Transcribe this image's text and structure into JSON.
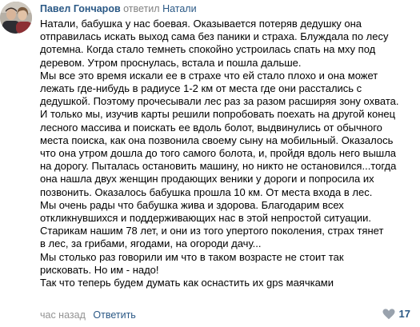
{
  "comment": {
    "author": "Павел Гончаров",
    "action": "ответил",
    "reply_to": "Натали",
    "lines": [
      "Натали, бабушка у нас боевая. Оказывается потеряв дедушку она",
      "отправилась искать выход сама без паники и страха. Блуждала по лесу",
      "дотемна. Когда стало темнеть спокойно устроилась спать на мху под",
      "деревом. Утром проснулась, встала и пошла дальше.",
      "Мы все это время искали ее в страхе что ей стало плохо и она может",
      "лежать где-нибудь в радиусе 1-2 км от места где они расстались с",
      "дедушкой. Поэтому прочесывали лес раз за разом расширяя зону охвата.",
      "И только мы, изучив карты решили попробовать поехать на другой конец",
      "лесного массива и поискать ее вдоль болот, выдвинулись от обычного",
      "места поиска, как она позвонила своему сыну на мобильный. Оказалось",
      "что она утром дошла до того самого болота, и, пройдя вдоль него вышла",
      "на дорогу. Пыталась остановить машину, но никто не остановился...тогда",
      "она нашла двух женщин продающих веники у дороги и попросила их",
      "позвонить. Оказалось бабушка прошла 10 км. От места входа в лес.",
      "Мы очень рады что бабушка жива и здорова. Благодарим всех",
      "откликнувшихся и поддерживающих нас в этой непростой ситуации.",
      "Старикам нашим 78 лет, и они из того упертого поколения, страх тянет",
      "в лес, за грибами, ягодами, на огороди дачу...",
      "Мы столько раз говорили им что в таком возрасте не стоит так",
      "рисковать. Но им - надо!",
      "Так что теперь будем думать как оснастить их gps маячками"
    ]
  },
  "footer": {
    "time": "час назад",
    "reply_label": "Ответить",
    "likes": "17"
  },
  "colors": {
    "link": "#2a5885",
    "meta": "#939393",
    "like_icon": "#99a2ad"
  },
  "icons": {
    "avatar": "avatar",
    "like": "heart-icon"
  }
}
